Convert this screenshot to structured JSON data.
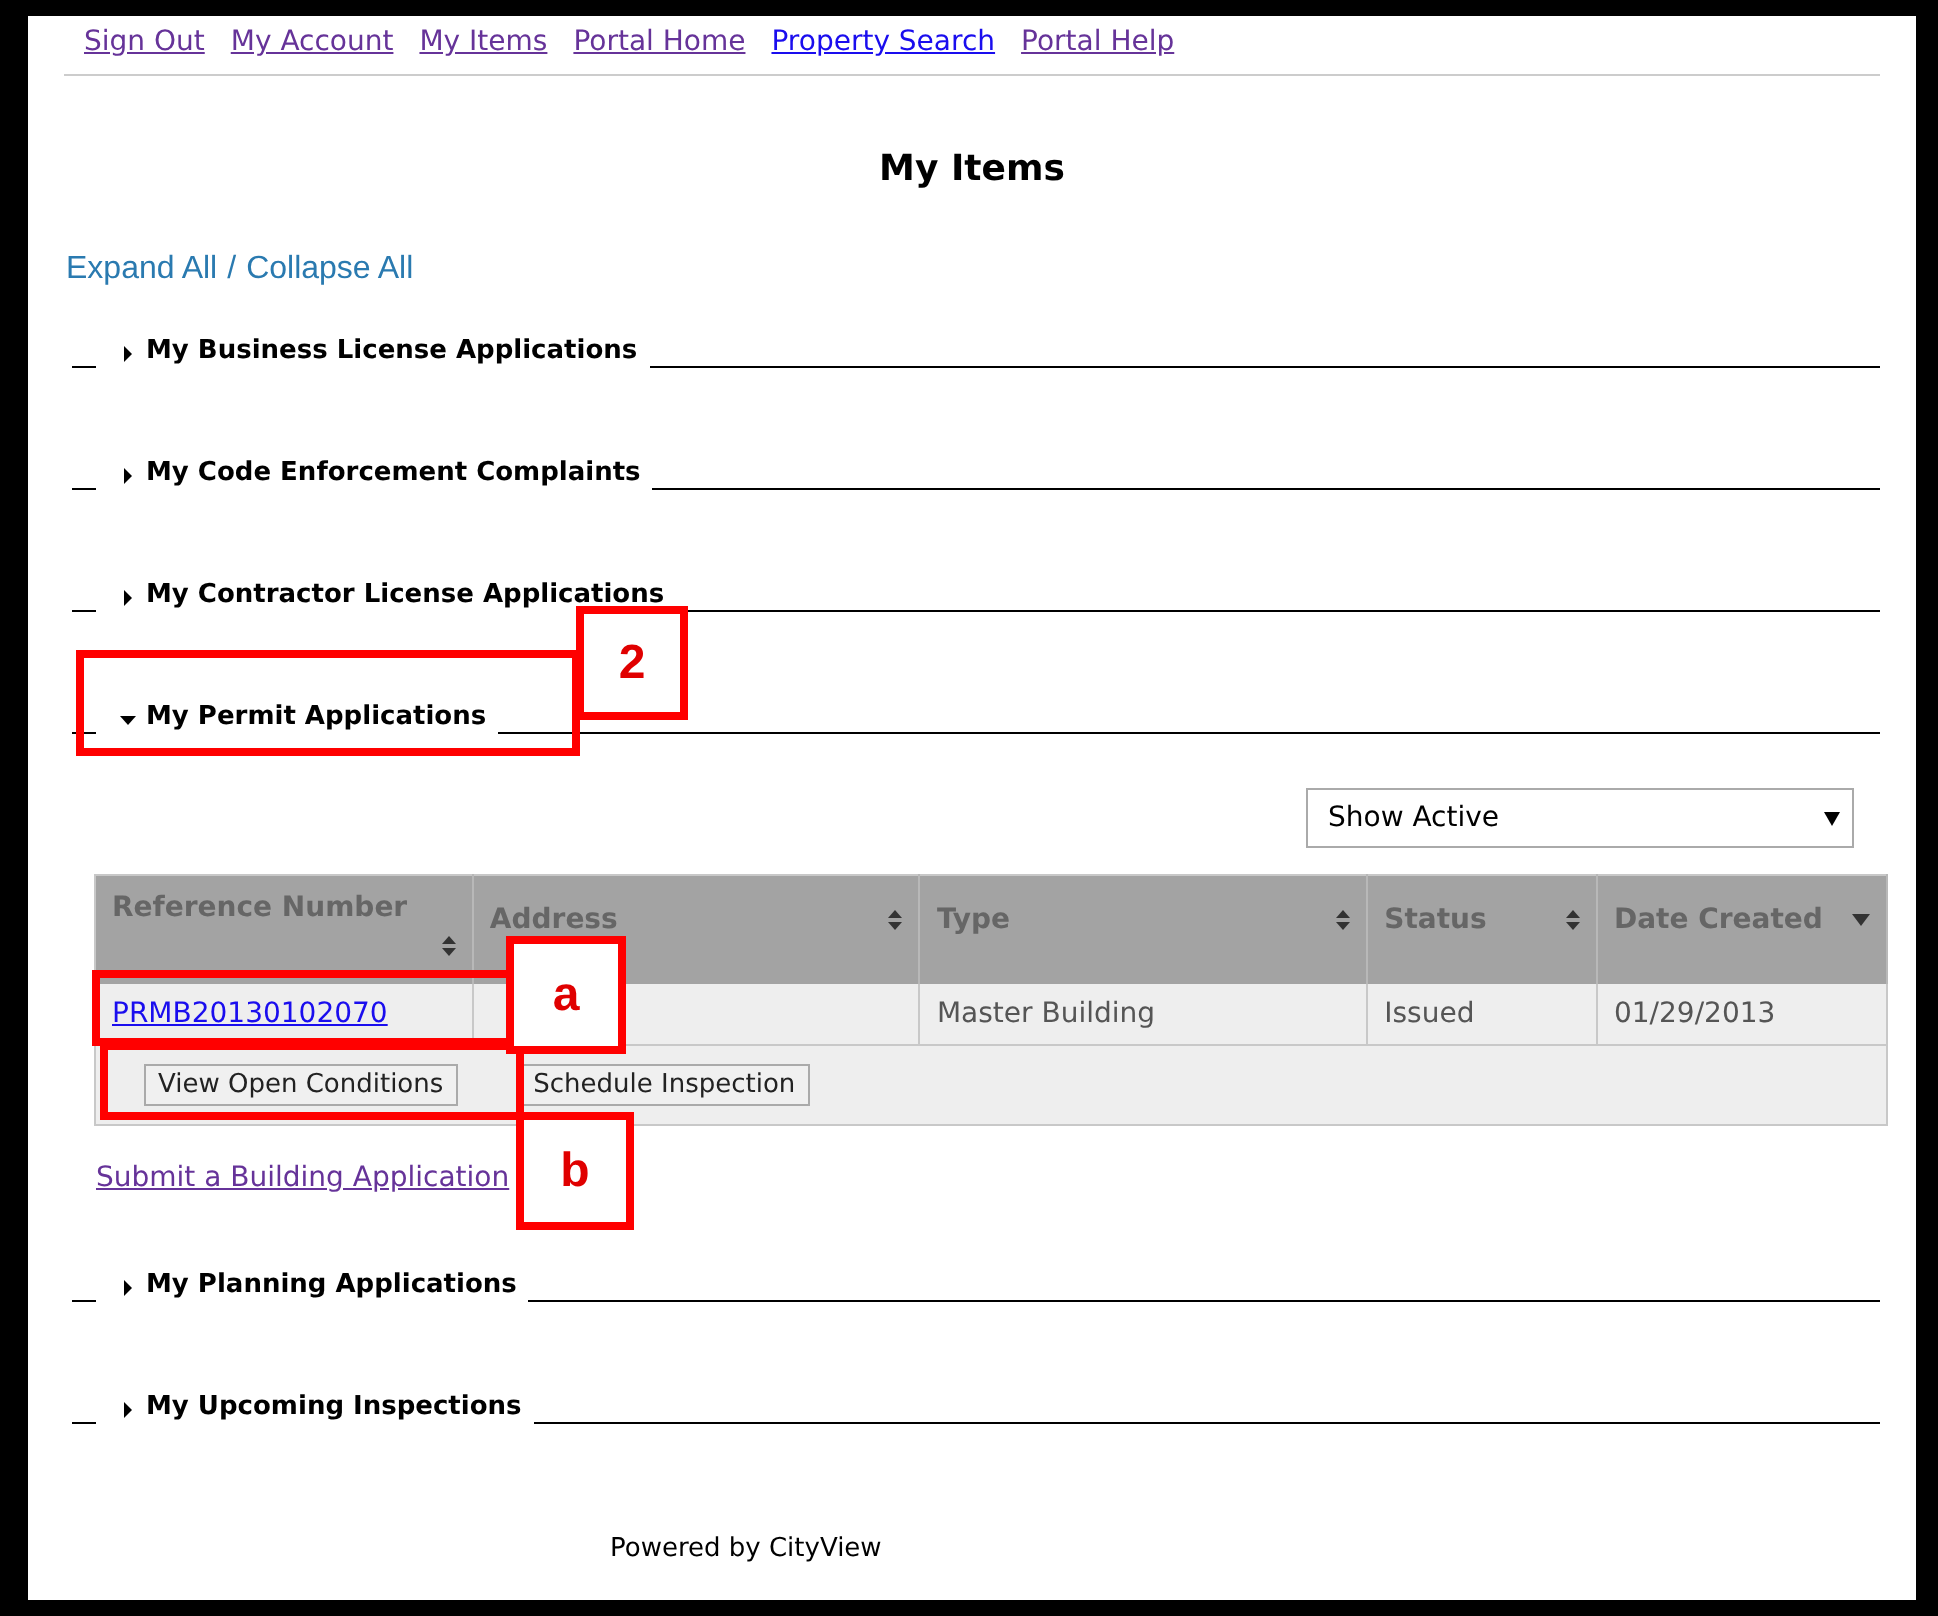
{
  "nav_links": [
    {
      "label": "Sign Out",
      "visited": true
    },
    {
      "label": "My Account",
      "visited": true
    },
    {
      "label": "My Items",
      "visited": true
    },
    {
      "label": "Portal Home",
      "visited": true
    },
    {
      "label": "Property Search",
      "visited": false
    },
    {
      "label": "Portal Help",
      "visited": true
    }
  ],
  "title": "My Items",
  "expand_all": "Expand All",
  "separator": "/",
  "collapse_all": "Collapse All",
  "sections_before": [
    {
      "title": "My Business License Applications",
      "expanded": false
    },
    {
      "title": "My Code Enforcement Complaints",
      "expanded": false
    },
    {
      "title": "My Contractor License Applications",
      "expanded": false
    },
    {
      "title": "My Permit Applications",
      "expanded": true
    }
  ],
  "permit_panel": {
    "filter": {
      "value": "Show Active"
    },
    "table": {
      "columns": [
        {
          "label": "Reference Number",
          "sorted": false
        },
        {
          "label": "Address",
          "sorted": false
        },
        {
          "label": "Type",
          "sorted": false
        },
        {
          "label": "Status",
          "sorted": false
        },
        {
          "label": "Date Created",
          "sorted": true
        }
      ],
      "rows": [
        {
          "reference": "PRMB20130102070",
          "type": "Master Building",
          "status": "Issued",
          "date": "01/29/2013"
        }
      ],
      "actions": [
        "View Open Conditions",
        "Schedule Inspection"
      ]
    },
    "submit_link": "Submit a Building Application"
  },
  "sections_after": [
    {
      "title": "My Planning Applications",
      "expanded": false
    },
    {
      "title": "My Upcoming Inspections",
      "expanded": false
    }
  ],
  "footer": "Powered by CityView",
  "callouts": [
    {
      "label": "2"
    },
    {
      "label": "a"
    },
    {
      "label": "b"
    }
  ]
}
